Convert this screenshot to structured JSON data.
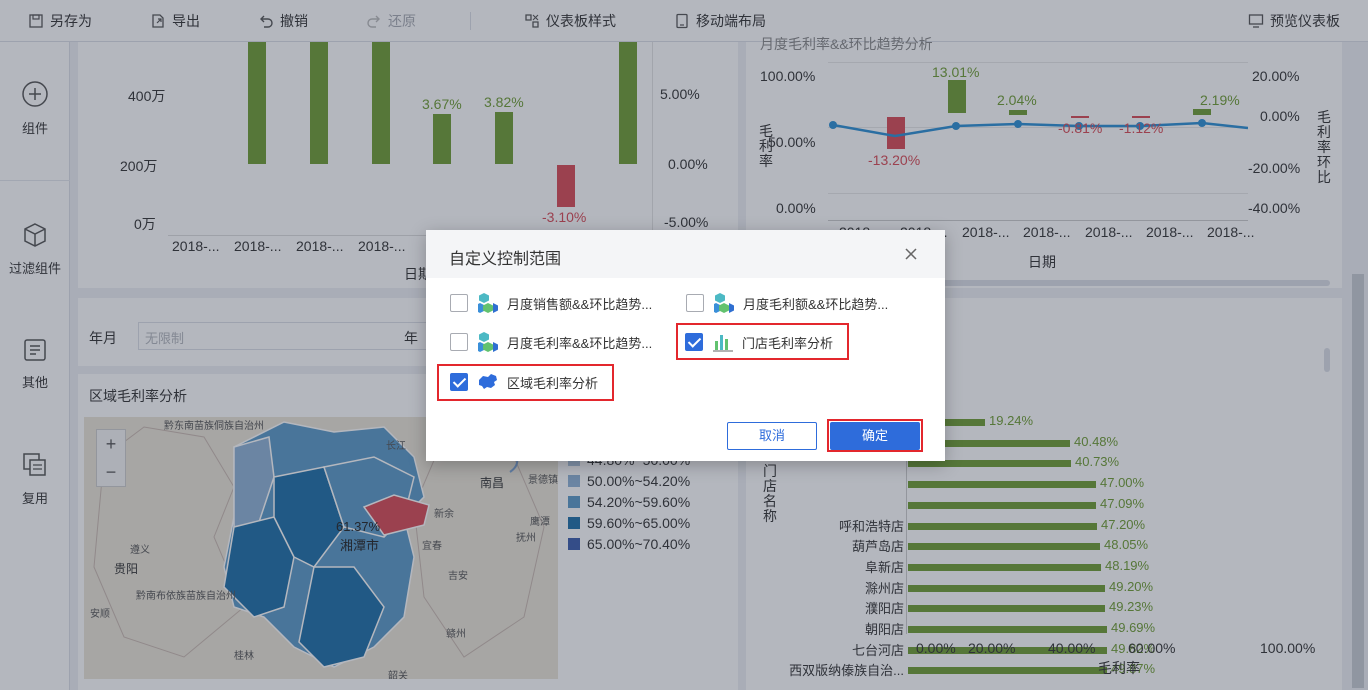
{
  "toolbar": {
    "save_as": "另存为",
    "export": "导出",
    "undo": "撤销",
    "redo": "还原",
    "dashboard_style": "仪表板样式",
    "mobile_layout": "移动端布局",
    "preview": "预览仪表板"
  },
  "sidebar": {
    "items": [
      {
        "label": "组件",
        "icon": "plus-circle-icon"
      },
      {
        "label": "过滤组件",
        "icon": "cube-icon"
      },
      {
        "label": "其他",
        "icon": "document-icon"
      },
      {
        "label": "复用",
        "icon": "copy-icon"
      }
    ]
  },
  "sales_chart": {
    "y_ticks": [
      "400万",
      "200万",
      "0万"
    ],
    "y2_ticks": [
      "5.00%",
      "0.00%",
      "-5.00%"
    ],
    "x_ticks": [
      "2018-...",
      "2018-...",
      "2018-...",
      "2018-..."
    ],
    "xlabel": "日期",
    "labels": [
      "3.67%",
      "3.82%",
      "-3.10%"
    ]
  },
  "margin_chart": {
    "title": "月度毛利率&&环比趋势分析",
    "y_ticks": [
      "100.00%",
      "50.00%",
      "0.00%"
    ],
    "y2_ticks": [
      "20.00%",
      "0.00%",
      "-20.00%",
      "-40.00%"
    ],
    "ylabel": "毛利率",
    "y2label": "毛利率环比",
    "x_ticks": [
      "2018-...",
      "2018-...",
      "2018-...",
      "2018-...",
      "2018-...",
      "2018-...",
      "2018-..."
    ],
    "xlabel": "日期",
    "labels": [
      "-13.20%",
      "13.01%",
      "2.04%",
      "-0.81%",
      "-1.12%",
      "2.19%"
    ]
  },
  "filter": {
    "label": "年月",
    "placeholder": "无限制",
    "label2": "年"
  },
  "region_map": {
    "title": "区域毛利率分析",
    "zoom_in": "+",
    "zoom_out": "−",
    "highlight_value": "61.37%",
    "highlight_city": "湘潭市",
    "legend": [
      {
        "label": "44.80%~50.00%",
        "color": "#b0c6de"
      },
      {
        "label": "50.00%~54.20%",
        "color": "#8fb3d6"
      },
      {
        "label": "54.20%~59.60%",
        "color": "#5b9ac8"
      },
      {
        "label": "59.60%~65.00%",
        "color": "#1e6fa8"
      },
      {
        "label": "65.00%~70.40%",
        "color": "#3b5cad"
      }
    ],
    "cities": [
      "黔东南苗族侗族自治州",
      "遵义",
      "贵阳",
      "黔南布依族苗族自治州",
      "安顺",
      "南昌",
      "抚州",
      "吉安",
      "赣州",
      "桂林",
      "长江",
      "宜春",
      "新余",
      "景德镇",
      "鹰潭",
      "韶关"
    ]
  },
  "store_chart": {
    "first_label": "19.24%",
    "ylabel": "门店名称",
    "xlabel": "毛利率",
    "x_ticks": [
      "0.00%",
      "20.00%",
      "40.00%",
      "60.00%",
      "100.00%"
    ],
    "rows": [
      {
        "name": "",
        "value": "19.24%",
        "frac": 0.1924
      },
      {
        "name": "",
        "value": "40.48%",
        "frac": 0.4048
      },
      {
        "name": "",
        "value": "40.73%",
        "frac": 0.4073
      },
      {
        "name": "",
        "value": "47.00%",
        "frac": 0.47
      },
      {
        "name": "",
        "value": "47.09%",
        "frac": 0.4709
      },
      {
        "name": "呼和浩特店",
        "value": "47.20%",
        "frac": 0.472
      },
      {
        "name": "葫芦岛店",
        "value": "48.05%",
        "frac": 0.4805
      },
      {
        "name": "阜新店",
        "value": "48.19%",
        "frac": 0.4819
      },
      {
        "name": "滁州店",
        "value": "49.20%",
        "frac": 0.492
      },
      {
        "name": "濮阳店",
        "value": "49.23%",
        "frac": 0.4923
      },
      {
        "name": "朝阳店",
        "value": "49.69%",
        "frac": 0.4969
      },
      {
        "name": "七台河店",
        "value": "49.82%",
        "frac": 0.4982
      },
      {
        "name": "西双版纳傣族自治...",
        "value": "49.87%",
        "frac": 0.4987
      }
    ]
  },
  "dialog": {
    "title": "自定义控制范围",
    "options": [
      {
        "label": "月度销售额&&环比趋势...",
        "checked": false,
        "icon": "cube-cluster-icon"
      },
      {
        "label": "月度毛利额&&环比趋势...",
        "checked": false,
        "icon": "cube-cluster-icon"
      },
      {
        "label": "月度毛利率&&环比趋势...",
        "checked": false,
        "icon": "cube-cluster-icon"
      },
      {
        "label": "门店毛利率分析",
        "checked": true,
        "icon": "bar-chart-icon"
      },
      {
        "label": "区域毛利率分析",
        "checked": true,
        "icon": "china-map-icon"
      }
    ],
    "cancel": "取消",
    "confirm": "确定"
  },
  "colors": {
    "accent": "#2e6cdb",
    "positive": "#6f9d33",
    "negative": "#d94b55",
    "highlight_border": "#e3272d"
  }
}
